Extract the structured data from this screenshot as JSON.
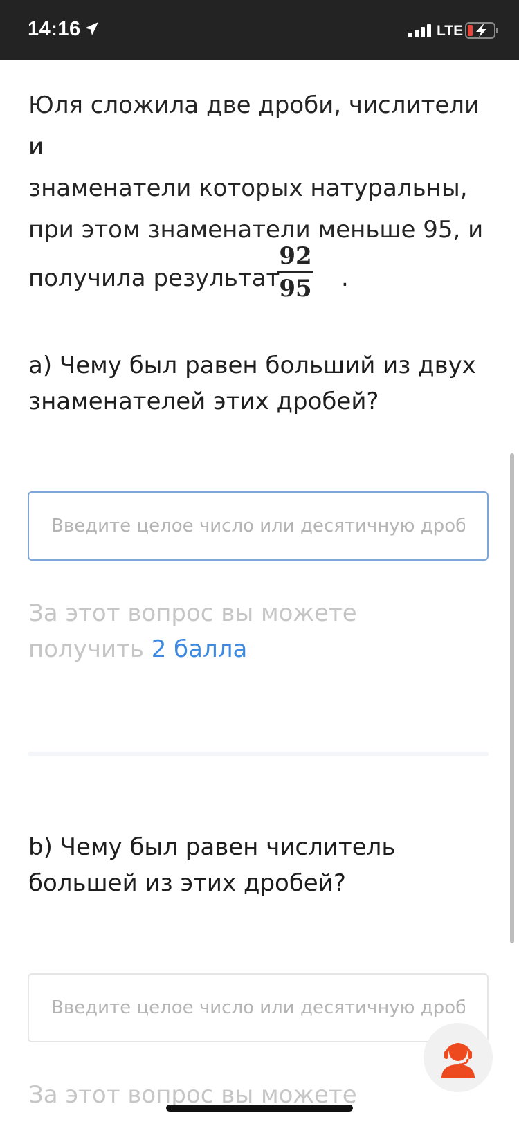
{
  "status_bar": {
    "time": "14:16",
    "network": "LTE",
    "icons": [
      "location-arrow-icon",
      "signal-icon",
      "battery-charging-icon"
    ]
  },
  "problem": {
    "line1": "Юля сложила две дроби, числители и",
    "line2": "знаменатели которых натуральны,",
    "line3": "при этом знаменатели меньше 95, и",
    "line4_prefix": "получила результат",
    "fraction_numerator": "92",
    "fraction_denominator": "95",
    "line4_suffix": "."
  },
  "question_a": {
    "line1": "а) Чему был равен больший из двух",
    "line2": "знаменателей этих дробей?",
    "input_placeholder": "Введите целое число или десятичную дробь",
    "input_value": "",
    "points_line1": "За этот вопрос вы можете",
    "points_prefix": "получить ",
    "points_value": "2 балла"
  },
  "question_b": {
    "line1": "b) Чему был равен числитель",
    "line2": "большей из этих дробей?",
    "input_placeholder": "Введите целое число или десятичную дробь",
    "input_value": "",
    "points_line1": "За этот вопрос вы можете"
  },
  "colors": {
    "status_bar_bg": "#232323",
    "accent_blue": "#3d8ae0",
    "support_orange": "#ee4a1f",
    "muted_text": "#c6c6c6"
  },
  "support_button_icon": "support-agent-icon"
}
